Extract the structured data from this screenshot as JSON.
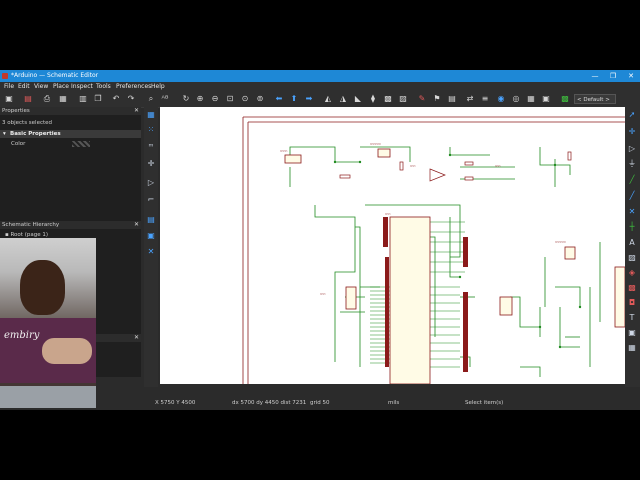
{
  "window": {
    "title": "*Arduino — Schematic Editor",
    "controls": [
      "—",
      "❐",
      "✕"
    ]
  },
  "menu": [
    "File",
    "Edit",
    "View",
    "Place",
    "Inspect",
    "Tools",
    "Preferences",
    "Help"
  ],
  "toolbar": {
    "unit_select": "< Default >"
  },
  "properties_panel": {
    "title": "Properties",
    "selection_count": "3 objects selected",
    "section": "Basic Properties",
    "rows": [
      {
        "label": "Color"
      }
    ]
  },
  "hierarchy_panel": {
    "title": "Schematic Hierarchy",
    "root": "Root (page 1)"
  },
  "status": {
    "coords": "X 5750  Y 4500",
    "delta": "dx 5700  dy 4450  dist 7231",
    "grid": "grid 50",
    "units": "mils",
    "message": "Select item(s)"
  },
  "webcam": {
    "shirt_text": "embiry"
  },
  "colors": {
    "titlebar": "#1e88d6",
    "app_bg": "#2b2b2b",
    "canvas_bg": "#ffffff",
    "wire": "#1f8a1f",
    "component": "#8b1a1a",
    "sheet_border": "#8b1a1a"
  }
}
